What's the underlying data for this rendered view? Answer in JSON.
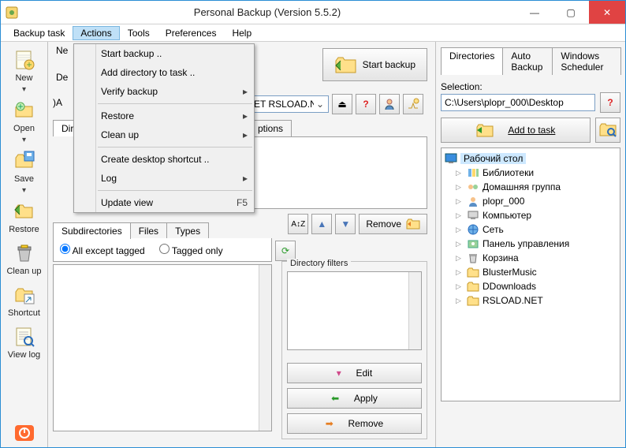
{
  "window": {
    "title": "Personal Backup (Version 5.5.2)"
  },
  "menubar": {
    "items": [
      "Backup task",
      "Actions",
      "Tools",
      "Preferences",
      "Help"
    ],
    "active_index": 1
  },
  "actions_menu": {
    "items": [
      {
        "label": "Start backup ..",
        "sub": false
      },
      {
        "label": "Add directory to task ..",
        "sub": false
      },
      {
        "label": "Verify backup",
        "sub": true
      },
      {
        "sep": true
      },
      {
        "label": "Restore",
        "sub": true
      },
      {
        "label": "Clean up",
        "sub": true
      },
      {
        "sep": true
      },
      {
        "label": "Create desktop shortcut ..",
        "sub": false
      },
      {
        "label": "Log",
        "sub": true
      },
      {
        "sep": true
      },
      {
        "label": "Update view",
        "sub": false,
        "shortcut": "F5"
      }
    ]
  },
  "sidebar": {
    "items": [
      {
        "label": "New",
        "icon": "note-new"
      },
      {
        "label": "Open",
        "icon": "folder-open"
      },
      {
        "label": "Save",
        "icon": "save"
      },
      {
        "label": "Restore",
        "icon": "restore"
      },
      {
        "label": "Clean up",
        "icon": "trash"
      },
      {
        "label": "Shortcut",
        "icon": "shortcut"
      },
      {
        "label": "View log",
        "icon": "note-log"
      }
    ]
  },
  "center": {
    "ne_label": "Ne",
    "de_label": "De",
    "a_prefix": ")A",
    "combo_value": "ET RSLOAD.NET",
    "start_backup_btn": "Start backup",
    "dir_tab_partial": "Dir",
    "options_tab_partial": "ptions",
    "subtab_labels": [
      "Subdirectories",
      "Files",
      "Types"
    ],
    "all_except": "All except tagged",
    "tagged_only": "Tagged only",
    "remove_btn": "Remove",
    "filters_legend": "Directory filters",
    "edit_btn": "Edit",
    "apply_btn": "Apply",
    "remove_btn2": "Remove"
  },
  "right": {
    "tabs": [
      "Directories",
      "Auto Backup",
      "Windows Scheduler"
    ],
    "selection_label": "Selection:",
    "path_value": "C:\\Users\\plopr_000\\Desktop",
    "add_to_task": "Add to task",
    "tree": {
      "root": "Рабочий стол",
      "children": [
        {
          "label": "Библиотеки",
          "icon": "libraries"
        },
        {
          "label": "Домашняя группа",
          "icon": "homegroup"
        },
        {
          "label": "plopr_000",
          "icon": "user"
        },
        {
          "label": "Компьютер",
          "icon": "computer"
        },
        {
          "label": "Сеть",
          "icon": "network"
        },
        {
          "label": "Панель управления",
          "icon": "control"
        },
        {
          "label": "Корзина",
          "icon": "bin"
        },
        {
          "label": "BlusterMusic",
          "icon": "folder"
        },
        {
          "label": "DDownloads",
          "icon": "folder"
        },
        {
          "label": "RSLOAD.NET",
          "icon": "folder"
        }
      ]
    }
  }
}
